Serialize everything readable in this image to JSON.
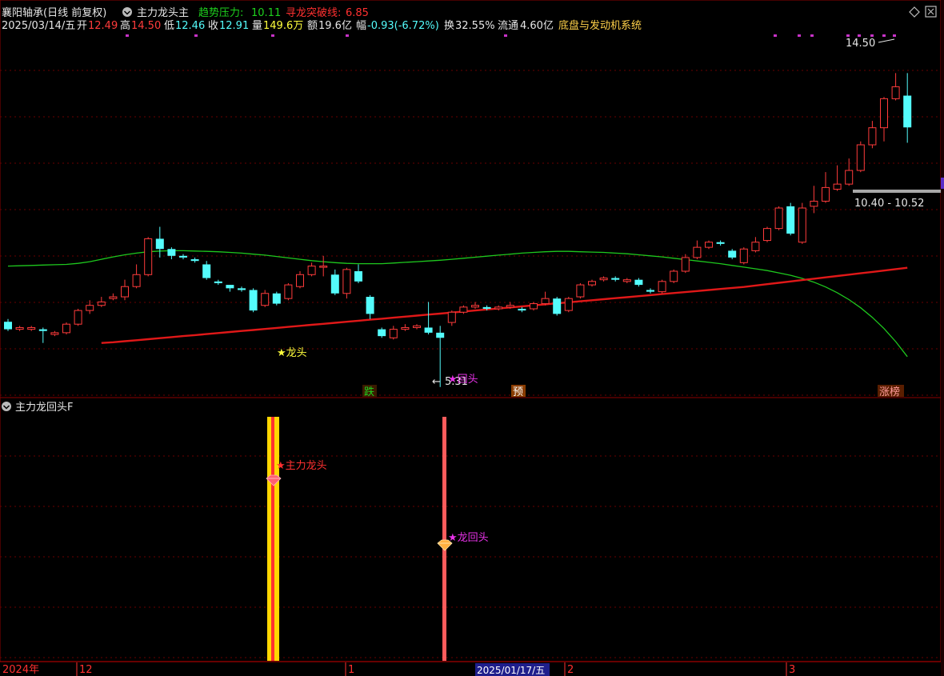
{
  "header": {
    "stock_title": "襄阳轴承(日线 前复权)",
    "indicator_name": "主力龙头主",
    "trend_label": "趋势压力:",
    "trend_value": "10.11",
    "seek_label": "寻龙突破线:",
    "seek_value": "6.85",
    "date": "2025/03/14/五",
    "open_label": "开",
    "open_value": "12.49",
    "high_label": "高",
    "high_value": "14.50",
    "low_label": "低",
    "low_value": "12.46",
    "close_label": "收",
    "close_value": "12.91",
    "volume_label": "量",
    "volume_value": "149.6万",
    "amount_label": "额",
    "amount_value": "19.6亿",
    "change_label": "幅",
    "change_value": "-0.93(-6.72%)",
    "turnover_label": "换",
    "turnover_value": "32.55%",
    "float_label": "流通",
    "float_value": "4.60亿",
    "system_name": "底盘与发动机系统"
  },
  "annotations": {
    "high_price": "14.50",
    "price_range": "10.40 - 10.52",
    "low_price": "5.31",
    "dragon_head": "★龙头",
    "return_head": "★回头",
    "tag_die": "跌",
    "tag_yu": "预",
    "tag_zhangbang": "涨榜"
  },
  "sub_panel": {
    "title": "主力龙回头F",
    "label_main": "★主力龙头",
    "label_return": "★龙回头"
  },
  "x_axis": {
    "year": "2024年",
    "labels": [
      "12",
      "1",
      "2",
      "3"
    ],
    "cursor_date": "2025/01/17/五"
  },
  "colors": {
    "up": "#ff3b3b",
    "down": "#54fcfc",
    "green_line": "#1ec81e",
    "red_line": "#e01818",
    "grid": "#6a0000"
  },
  "chart_data": {
    "type": "candlestick",
    "candles": [
      [
        7.22,
        7.0,
        7.3,
        6.95
      ],
      [
        7.0,
        7.05,
        7.1,
        6.95
      ],
      [
        7.0,
        7.05,
        7.1,
        6.95
      ],
      [
        7.0,
        6.95,
        7.05,
        6.6
      ],
      [
        6.85,
        6.9,
        6.95,
        6.8
      ],
      [
        6.9,
        7.15,
        7.2,
        6.85
      ],
      [
        7.15,
        7.55,
        7.6,
        7.1
      ],
      [
        7.55,
        7.7,
        7.85,
        7.45
      ],
      [
        7.7,
        7.8,
        7.95,
        7.65
      ],
      [
        7.9,
        7.95,
        8.05,
        7.85
      ],
      [
        7.95,
        8.25,
        8.45,
        7.85
      ],
      [
        8.25,
        8.6,
        8.9,
        8.2
      ],
      [
        8.6,
        9.65,
        9.7,
        8.55
      ],
      [
        9.65,
        9.35,
        10.0,
        9.1
      ],
      [
        9.35,
        9.15,
        9.4,
        9.05
      ],
      [
        9.15,
        9.1,
        9.2,
        9.05
      ],
      [
        9.05,
        9.0,
        9.1,
        8.95
      ],
      [
        8.9,
        8.5,
        9.0,
        8.45
      ],
      [
        8.4,
        8.35,
        8.45,
        8.3
      ],
      [
        8.3,
        8.2,
        8.3,
        8.1
      ],
      [
        8.2,
        8.15,
        8.25,
        8.1
      ],
      [
        8.15,
        7.55,
        8.2,
        7.5
      ],
      [
        7.7,
        8.05,
        8.15,
        7.65
      ],
      [
        8.05,
        7.75,
        8.1,
        7.7
      ],
      [
        7.9,
        8.3,
        8.35,
        7.85
      ],
      [
        8.25,
        8.6,
        8.7,
        8.2
      ],
      [
        8.6,
        8.85,
        8.95,
        8.55
      ],
      [
        8.85,
        8.85,
        9.15,
        8.55
      ],
      [
        8.6,
        8.05,
        8.75,
        8.0
      ],
      [
        8.05,
        8.75,
        8.8,
        7.9
      ],
      [
        8.7,
        8.4,
        8.9,
        8.35
      ],
      [
        7.95,
        7.45,
        8.0,
        7.3
      ],
      [
        7.0,
        6.8,
        7.05,
        6.75
      ],
      [
        6.75,
        7.0,
        7.1,
        6.7
      ],
      [
        7.0,
        7.05,
        7.15,
        6.95
      ],
      [
        7.05,
        7.1,
        7.15,
        7.0
      ],
      [
        7.05,
        6.9,
        7.8,
        6.85
      ],
      [
        6.9,
        6.75,
        7.1,
        5.31
      ],
      [
        7.2,
        7.5,
        7.55,
        7.1
      ],
      [
        7.5,
        7.65,
        7.7,
        7.45
      ],
      [
        7.65,
        7.7,
        7.8,
        7.6
      ],
      [
        7.65,
        7.6,
        7.7,
        7.55
      ],
      [
        7.6,
        7.65,
        7.7,
        7.55
      ],
      [
        7.65,
        7.7,
        7.8,
        7.6
      ],
      [
        7.6,
        7.55,
        7.65,
        7.5
      ],
      [
        7.6,
        7.75,
        7.8,
        7.55
      ],
      [
        7.75,
        7.9,
        8.1,
        7.7
      ],
      [
        7.9,
        7.45,
        7.95,
        7.4
      ],
      [
        7.55,
        7.9,
        7.95,
        7.5
      ],
      [
        7.95,
        8.3,
        8.35,
        7.9
      ],
      [
        8.3,
        8.4,
        8.45,
        8.25
      ],
      [
        8.45,
        8.5,
        8.55,
        8.4
      ],
      [
        8.5,
        8.45,
        8.55,
        8.4
      ],
      [
        8.4,
        8.45,
        8.5,
        8.35
      ],
      [
        8.45,
        8.3,
        8.5,
        8.25
      ],
      [
        8.15,
        8.1,
        8.2,
        8.05
      ],
      [
        8.1,
        8.4,
        8.45,
        8.05
      ],
      [
        8.4,
        8.7,
        8.75,
        8.35
      ],
      [
        8.7,
        9.1,
        9.2,
        8.65
      ],
      [
        9.1,
        9.4,
        9.6,
        9.05
      ],
      [
        9.4,
        9.55,
        9.6,
        9.35
      ],
      [
        9.55,
        9.5,
        9.6,
        9.45
      ],
      [
        9.3,
        9.1,
        9.35,
        9.05
      ],
      [
        8.95,
        9.35,
        9.4,
        8.9
      ],
      [
        9.3,
        9.55,
        9.7,
        9.25
      ],
      [
        9.6,
        9.95,
        10.0,
        9.55
      ],
      [
        9.95,
        10.55,
        10.6,
        9.9
      ],
      [
        10.6,
        9.8,
        10.7,
        9.75
      ],
      [
        9.55,
        10.55,
        10.7,
        9.5
      ],
      [
        10.6,
        10.75,
        11.2,
        10.4
      ],
      [
        10.75,
        11.15,
        11.6,
        10.7
      ],
      [
        11.1,
        11.25,
        11.8,
        11.05
      ],
      [
        11.25,
        11.65,
        12.0,
        11.2
      ],
      [
        11.65,
        12.4,
        12.5,
        11.6
      ],
      [
        12.4,
        12.9,
        13.1,
        12.3
      ],
      [
        12.9,
        13.75,
        13.8,
        12.5
      ],
      [
        13.75,
        14.1,
        14.5,
        13.7
      ],
      [
        13.84,
        12.91,
        14.5,
        12.46
      ]
    ],
    "green_ma": [
      8.85,
      8.86,
      8.87,
      8.88,
      8.89,
      8.9,
      8.93,
      8.98,
      9.05,
      9.12,
      9.18,
      9.23,
      9.27,
      9.29,
      9.3,
      9.3,
      9.29,
      9.28,
      9.27,
      9.25,
      9.23,
      9.2,
      9.17,
      9.13,
      9.09,
      9.05,
      9.01,
      8.98,
      8.95,
      8.93,
      8.92,
      8.92,
      8.92,
      8.94,
      8.96,
      8.98,
      9.0,
      9.02,
      9.05,
      9.08,
      9.11,
      9.14,
      9.17,
      9.2,
      9.23,
      9.25,
      9.27,
      9.28,
      9.28,
      9.27,
      9.26,
      9.25,
      9.23,
      9.21,
      9.18,
      9.15,
      9.12,
      9.08,
      9.04,
      9.0,
      8.96,
      8.92,
      8.87,
      8.82,
      8.77,
      8.72,
      8.65,
      8.58,
      8.49,
      8.38,
      8.24,
      8.07,
      7.87,
      7.63,
      7.35,
      7.02,
      6.64,
      6.2
    ],
    "red_ma": [
      null,
      null,
      null,
      null,
      null,
      null,
      null,
      null,
      6.6,
      6.62,
      6.65,
      6.68,
      6.71,
      6.74,
      6.77,
      6.8,
      6.83,
      6.86,
      6.89,
      6.92,
      6.95,
      6.98,
      7.01,
      7.04,
      7.07,
      7.1,
      7.13,
      7.16,
      7.19,
      7.22,
      7.25,
      7.28,
      7.31,
      7.34,
      7.37,
      7.4,
      7.43,
      7.46,
      7.49,
      7.52,
      7.55,
      7.58,
      7.61,
      7.64,
      7.67,
      7.7,
      7.73,
      7.76,
      7.79,
      7.82,
      7.85,
      7.88,
      7.91,
      7.94,
      7.97,
      8.0,
      8.03,
      8.06,
      8.09,
      8.12,
      8.15,
      8.18,
      8.21,
      8.24,
      8.28,
      8.32,
      8.36,
      8.4,
      8.44,
      8.48,
      8.52,
      8.56,
      8.6,
      8.64,
      8.68,
      8.72,
      8.76,
      8.8
    ],
    "ylim": [
      5.0,
      15.0
    ],
    "signals": [
      {
        "label": "★龙头",
        "index": 21
      },
      {
        "label": "★回头",
        "index": 37
      }
    ]
  }
}
